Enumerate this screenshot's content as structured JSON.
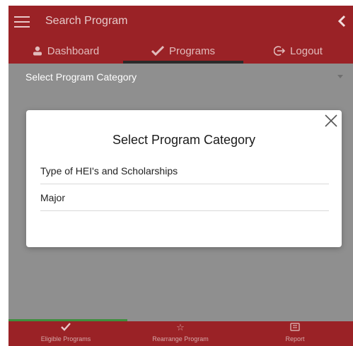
{
  "header": {
    "title": "Search Program",
    "menu_icon": "hamburger-menu-icon",
    "back_icon": "chevron-left-icon"
  },
  "tabs": [
    {
      "label": "Dashboard",
      "icon": "person-icon",
      "active": false
    },
    {
      "label": "Programs",
      "icon": "checkmark-icon",
      "active": true
    },
    {
      "label": "Logout",
      "icon": "logout-icon",
      "active": false
    }
  ],
  "select": {
    "label": "Select Program Category"
  },
  "dialog": {
    "title": "Select Program Category",
    "options": [
      {
        "label": "Type of HEI's and Scholarships"
      },
      {
        "label": "Major"
      }
    ]
  },
  "bottom_nav": [
    {
      "label": "Eligible Programs",
      "icon": "checkmark-icon",
      "active": true
    },
    {
      "label": "Rearrange Program",
      "icon": "star-icon",
      "active": false
    },
    {
      "label": "Report",
      "icon": "report-icon",
      "active": false
    }
  ],
  "colors": {
    "header_bg": "#9a2226",
    "overlay": "#8f8f8f",
    "active_underline": "#2b2b2b",
    "bottom_accent": "#3e8f3e"
  }
}
